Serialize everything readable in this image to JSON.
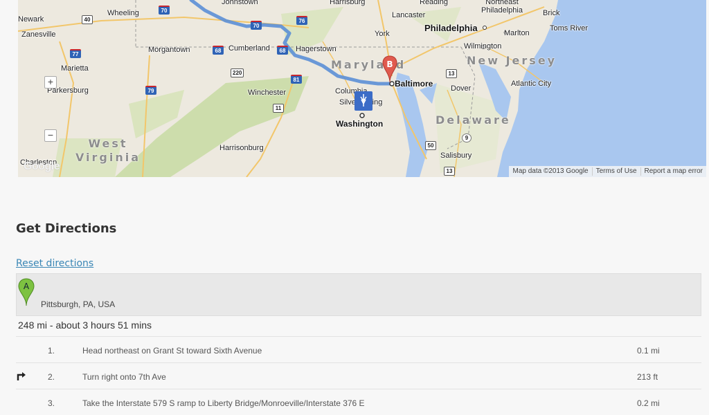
{
  "map": {
    "places": [
      {
        "name": "Newark",
        "cls": ""
      },
      {
        "name": "Wheeling",
        "cls": ""
      },
      {
        "name": "Johnstown",
        "cls": ""
      },
      {
        "name": "Harrisburg",
        "cls": ""
      },
      {
        "name": "Reading",
        "cls": ""
      },
      {
        "name": "Northeast Philadelphia",
        "cls": ""
      },
      {
        "name": "Brick",
        "cls": ""
      },
      {
        "name": "Zanesville",
        "cls": ""
      },
      {
        "name": "Lancaster",
        "cls": ""
      },
      {
        "name": "York",
        "cls": ""
      },
      {
        "name": "Philadelphia",
        "cls": "bigcity"
      },
      {
        "name": "Marlton",
        "cls": ""
      },
      {
        "name": "Toms River",
        "cls": ""
      },
      {
        "name": "Morgantown",
        "cls": ""
      },
      {
        "name": "Cumberland",
        "cls": ""
      },
      {
        "name": "Hagerstown",
        "cls": ""
      },
      {
        "name": "Wilmington",
        "cls": ""
      },
      {
        "name": "Marietta",
        "cls": ""
      },
      {
        "name": "Maryland",
        "cls": "state"
      },
      {
        "name": "New Jersey",
        "cls": "state"
      },
      {
        "name": "Baltimore",
        "cls": "city"
      },
      {
        "name": "Parkersburg",
        "cls": ""
      },
      {
        "name": "Winchester",
        "cls": ""
      },
      {
        "name": "Columbia",
        "cls": ""
      },
      {
        "name": "Dover",
        "cls": ""
      },
      {
        "name": "Atlantic City",
        "cls": ""
      },
      {
        "name": "Silver Spring",
        "cls": ""
      },
      {
        "name": "Washington",
        "cls": "city"
      },
      {
        "name": "Delaware",
        "cls": "state"
      },
      {
        "name": "West Virginia",
        "cls": "state"
      },
      {
        "name": "Harrisonburg",
        "cls": ""
      },
      {
        "name": "Salisbury",
        "cls": ""
      },
      {
        "name": "Charleston",
        "cls": ""
      }
    ],
    "shields": [
      {
        "label": "70",
        "type": "i"
      },
      {
        "label": "40",
        "type": "us"
      },
      {
        "label": "76",
        "type": "i"
      },
      {
        "label": "77",
        "type": "i"
      },
      {
        "label": "68",
        "type": "i"
      },
      {
        "label": "68",
        "type": "i"
      },
      {
        "label": "70",
        "type": "i"
      },
      {
        "label": "220",
        "type": "us"
      },
      {
        "label": "81",
        "type": "i"
      },
      {
        "label": "79",
        "type": "i"
      },
      {
        "label": "11",
        "type": "us"
      },
      {
        "label": "13",
        "type": "us"
      },
      {
        "label": "50",
        "type": "us"
      },
      {
        "label": "9",
        "type": "st"
      },
      {
        "label": "13",
        "type": "us"
      }
    ],
    "zoom_in": "+",
    "zoom_out": "−",
    "marker_b": "B",
    "logo": "Google",
    "footer": [
      "Map data ©2013 Google",
      "Terms of Use",
      "Report a map error"
    ],
    "colors": {
      "water": "#a9c7ef",
      "land": "#ede9df",
      "green": "#c8dba4",
      "route": "#5b8fd6",
      "marker_red": "#e05a4e"
    }
  },
  "directions": {
    "title": "Get Directions",
    "reset_label": "Reset directions",
    "origin_marker": "A",
    "origin": "Pittsburgh, PA, USA",
    "summary": "248 mi - about 3 hours 51 mins",
    "steps": [
      {
        "num": "1.",
        "text": "Head northeast on Grant St toward Sixth Avenue",
        "dist": "0.1 mi",
        "turn": false
      },
      {
        "num": "2.",
        "text": "Turn right onto 7th Ave",
        "dist": "213 ft",
        "turn": true
      },
      {
        "num": "3.",
        "text": "Take the Interstate 579 S ramp to Liberty Bridge/Monroeville/Interstate 376 E",
        "dist": "0.2 mi",
        "turn": false
      }
    ]
  }
}
